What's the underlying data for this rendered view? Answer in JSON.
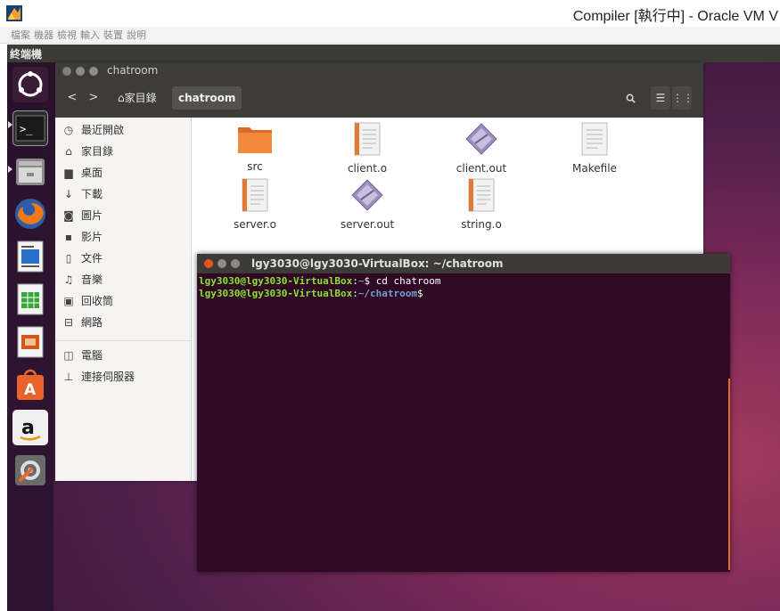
{
  "host": {
    "title": "Compiler [執行中] - Oracle VM V",
    "menu": [
      "檔案",
      "機器",
      "檢視",
      "輸入",
      "裝置",
      "說明"
    ]
  },
  "panel": {
    "title": "終端機"
  },
  "launcher": {
    "items": [
      "ubuntu-dash",
      "terminal",
      "files",
      "firefox",
      "libreoffice-writer",
      "libreoffice-calc",
      "libreoffice-impress",
      "ubuntu-software",
      "amazon",
      "system-settings"
    ]
  },
  "file_manager": {
    "window_title": "chatroom",
    "path": {
      "home": "家目錄",
      "current": "chatroom"
    },
    "sidebar": [
      {
        "icon": "clock-icon",
        "label": "最近開啟"
      },
      {
        "icon": "home-icon",
        "label": "家目錄"
      },
      {
        "icon": "folder-icon",
        "label": "桌面"
      },
      {
        "icon": "download-icon",
        "label": "下載"
      },
      {
        "icon": "camera-icon",
        "label": "圖片"
      },
      {
        "icon": "video-icon",
        "label": "影片"
      },
      {
        "icon": "document-icon",
        "label": "文件"
      },
      {
        "icon": "music-icon",
        "label": "音樂"
      },
      {
        "icon": "trash-icon",
        "label": "回收筒"
      },
      {
        "icon": "network-icon",
        "label": "網路"
      },
      {
        "icon": "computer-icon",
        "label": "電腦"
      },
      {
        "icon": "server-icon",
        "label": "連接伺服器"
      }
    ],
    "files": [
      {
        "name": "src",
        "type": "folder"
      },
      {
        "name": "client.o",
        "type": "text"
      },
      {
        "name": "client.out",
        "type": "exec"
      },
      {
        "name": "Makefile",
        "type": "text-plain"
      },
      {
        "name": "server.o",
        "type": "text"
      },
      {
        "name": "server.out",
        "type": "exec"
      },
      {
        "name": "string.o",
        "type": "text"
      }
    ]
  },
  "terminal": {
    "title": "lgy3030@lgy3030-VirtualBox: ~/chatroom",
    "lines": [
      {
        "user": "lgy3030@lgy3030-VirtualBox",
        "path": "~",
        "prompt": "$ ",
        "cmd": "cd chatroom"
      },
      {
        "user": "lgy3030@lgy3030-VirtualBox",
        "path": "~/chatroom",
        "prompt": "$",
        "cmd": ""
      }
    ]
  }
}
